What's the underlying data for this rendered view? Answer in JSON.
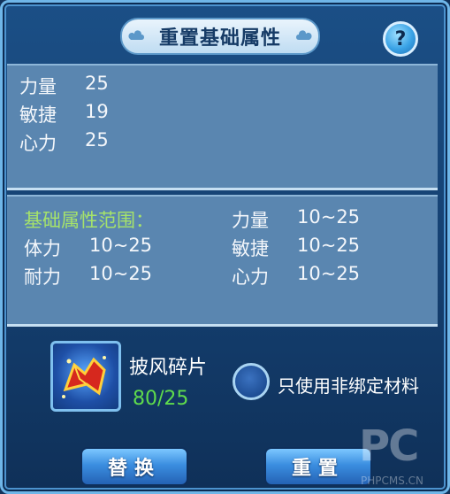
{
  "title": "重置基础属性",
  "help": {
    "glyph": "?"
  },
  "current_stats": [
    {
      "name": "力量",
      "value": "25"
    },
    {
      "name": "敏捷",
      "value": "19"
    },
    {
      "name": "心力",
      "value": "25"
    }
  ],
  "range": {
    "heading": "基础属性范围：",
    "items": [
      {
        "name": "力量",
        "range": "10~25"
      },
      {
        "name": "体力",
        "range": "10~25"
      },
      {
        "name": "敏捷",
        "range": "10~25"
      },
      {
        "name": "耐力",
        "range": "10~25"
      },
      {
        "name": "心力",
        "range": "10~25"
      }
    ]
  },
  "material": {
    "icon": "cape-shard-icon",
    "name": "披风碎片",
    "count": "80/25",
    "count_color": "#5fdb4c"
  },
  "option": {
    "label": "只使用非绑定材料"
  },
  "buttons": {
    "replace": "替换",
    "reset": "重置"
  },
  "watermark": {
    "big": "PC",
    "small": "PHPCMS.CN"
  },
  "colors": {
    "accent": "#a6e36a",
    "panel": "#5a86b0"
  }
}
